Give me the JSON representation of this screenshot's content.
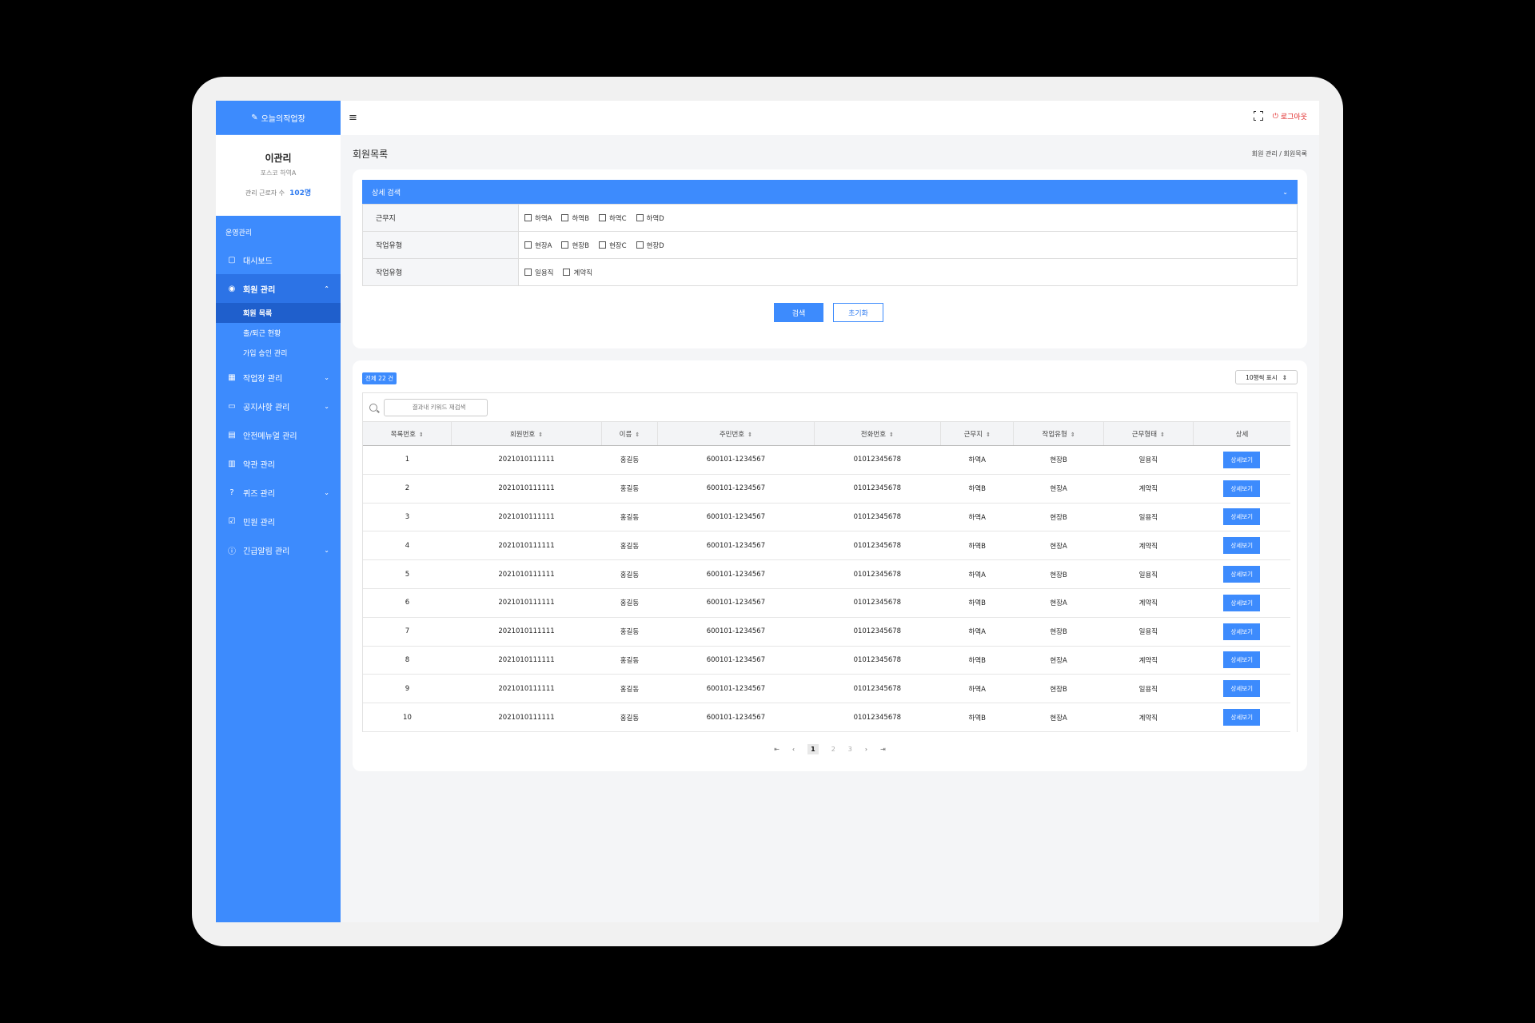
{
  "app": {
    "logo": "오늘의작업장",
    "logo_icon": "pencil-icon"
  },
  "profile": {
    "name": "이관리",
    "org": "포스코 하역A",
    "count_label": "관리 근로자 수",
    "count_value": "102명"
  },
  "sidebar": {
    "section": "운영관리",
    "items": [
      {
        "label": "대시보드",
        "icon": "dashboard-icon"
      },
      {
        "label": "회원 관리",
        "icon": "user-icon"
      },
      {
        "label": "작업장 관리",
        "icon": "building-icon"
      },
      {
        "label": "공지사항 관리",
        "icon": "message-icon"
      },
      {
        "label": "안전메뉴얼 관리",
        "icon": "book-icon"
      },
      {
        "label": "약관 관리",
        "icon": "document-icon"
      },
      {
        "label": "퀴즈 관리",
        "icon": "question-icon"
      },
      {
        "label": "민원 관리",
        "icon": "check-icon"
      },
      {
        "label": "긴급알림 관리",
        "icon": "alert-icon"
      }
    ],
    "sub_items": [
      {
        "label": "회원 목록"
      },
      {
        "label": "출/퇴근 현황"
      },
      {
        "label": "가입 승인 관리"
      }
    ]
  },
  "topbar": {
    "logout": "로그아웃"
  },
  "page": {
    "title": "회원목록",
    "breadcrumb": "회원 관리  /  회원목록"
  },
  "search": {
    "header": "상세 검색",
    "rows": [
      {
        "label": "근무지",
        "options": [
          "하역A",
          "하역B",
          "하역C",
          "하역D"
        ]
      },
      {
        "label": "작업유형",
        "options": [
          "현장A",
          "현장B",
          "현장C",
          "현장D"
        ]
      },
      {
        "label": "작업유형",
        "options": [
          "일용직",
          "계약직"
        ]
      }
    ],
    "search_button": "검색",
    "reset_button": "초기화"
  },
  "list": {
    "total": "전체 22 건",
    "per_page": "10행씩 표시",
    "filter_placeholder": "결과내 키워드 재검색",
    "columns": [
      "목록번호",
      "회원번호",
      "이름",
      "주민번호",
      "전화번호",
      "근무지",
      "작업유형",
      "근무형태",
      "상세"
    ],
    "detail_label": "상세보기",
    "rows": [
      [
        "1",
        "2021010111111",
        "홍길동",
        "600101-1234567",
        "01012345678",
        "하역A",
        "현장B",
        "일용직"
      ],
      [
        "2",
        "2021010111111",
        "홍길동",
        "600101-1234567",
        "01012345678",
        "하역B",
        "현장A",
        "계약직"
      ],
      [
        "3",
        "2021010111111",
        "홍길동",
        "600101-1234567",
        "01012345678",
        "하역A",
        "현장B",
        "일용직"
      ],
      [
        "4",
        "2021010111111",
        "홍길동",
        "600101-1234567",
        "01012345678",
        "하역B",
        "현장A",
        "계약직"
      ],
      [
        "5",
        "2021010111111",
        "홍길동",
        "600101-1234567",
        "01012345678",
        "하역A",
        "현장B",
        "일용직"
      ],
      [
        "6",
        "2021010111111",
        "홍길동",
        "600101-1234567",
        "01012345678",
        "하역B",
        "현장A",
        "계약직"
      ],
      [
        "7",
        "2021010111111",
        "홍길동",
        "600101-1234567",
        "01012345678",
        "하역A",
        "현장B",
        "일용직"
      ],
      [
        "8",
        "2021010111111",
        "홍길동",
        "600101-1234567",
        "01012345678",
        "하역B",
        "현장A",
        "계약직"
      ],
      [
        "9",
        "2021010111111",
        "홍길동",
        "600101-1234567",
        "01012345678",
        "하역A",
        "현장B",
        "일용직"
      ],
      [
        "10",
        "2021010111111",
        "홍길동",
        "600101-1234567",
        "01012345678",
        "하역B",
        "현장A",
        "계약직"
      ]
    ],
    "pages": [
      "1",
      "2",
      "3"
    ]
  },
  "colors": {
    "primary": "#3d8bfd",
    "logout": "#e02424"
  }
}
